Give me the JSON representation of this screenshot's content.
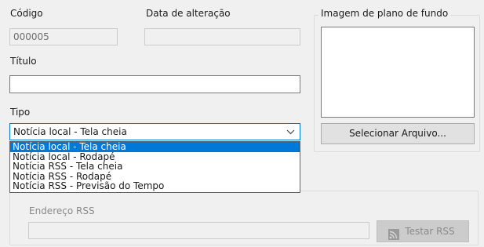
{
  "form": {
    "codigo_label": "Código",
    "codigo_value": "000005",
    "data_alteracao_label": "Data de alteração",
    "data_alteracao_value": "",
    "titulo_label": "Título",
    "titulo_value": "",
    "tipo_label": "Tipo",
    "tipo_selected": "Notícia local - Tela cheia",
    "tipo_arrow_icon": "chevron-down-icon",
    "tipo_options": [
      "Notícia local - Tela cheia",
      "Notícia local - Rodapé",
      "Notícia RSS - Tela cheia",
      "Notícia RSS - Rodapé",
      "Notícia RSS - Previsão do Tempo"
    ]
  },
  "background_image": {
    "group_title": "Imagem de plano de fundo",
    "select_button": "Selecionar Arquivo..."
  },
  "rss": {
    "endereco_label": "Endereço RSS",
    "endereco_value": "",
    "test_button": "Testar RSS",
    "test_icon": "rss-icon"
  },
  "colors": {
    "accent": "#0078d7",
    "window_bg": "#f0f0f0"
  }
}
